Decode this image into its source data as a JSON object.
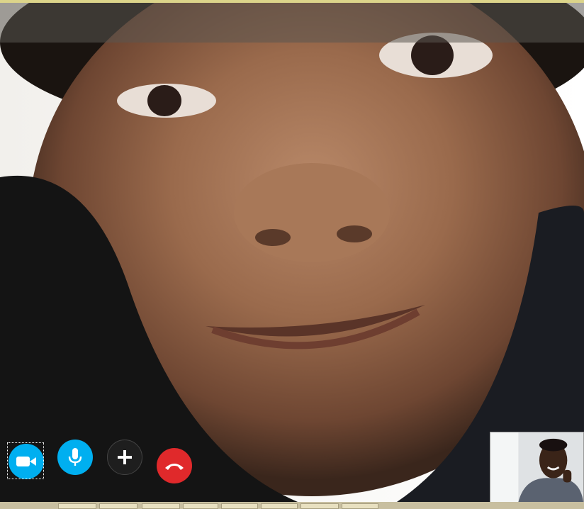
{
  "call": {
    "remote_video": {
      "description_icon": "remote-participant-video"
    },
    "self_view": {
      "icon": "self-camera-preview"
    },
    "controls": [
      {
        "name": "video-toggle-button",
        "icon": "video-camera-icon",
        "color": "#00aff0"
      },
      {
        "name": "microphone-button",
        "icon": "microphone-icon",
        "color": "#00aff0"
      },
      {
        "name": "add-button",
        "icon": "plus-icon",
        "color": "#1e1e1e"
      },
      {
        "name": "end-call-button",
        "icon": "hang-up-icon",
        "color": "#e0292b"
      }
    ]
  },
  "colors": {
    "accent": "#00aff0",
    "end_call": "#e0292b",
    "top_accent": "#dcd48a",
    "taskbar": "#c8bfa0"
  }
}
